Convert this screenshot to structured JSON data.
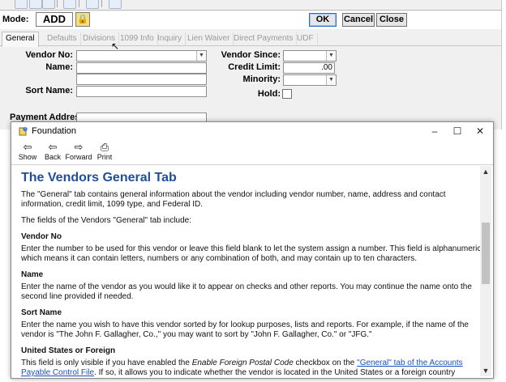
{
  "mode": {
    "label": "Mode:",
    "value": "ADD"
  },
  "header_buttons": {
    "ok": "OK",
    "cancel": "Cancel",
    "close": "Close"
  },
  "tabs": [
    {
      "label": "General",
      "active": true
    },
    {
      "label": "Defaults"
    },
    {
      "label": "Divisions"
    },
    {
      "label": "1099 Info"
    },
    {
      "label": "Inquiry"
    },
    {
      "label": "Lien Waiver"
    },
    {
      "label": "Direct Payments"
    },
    {
      "label": "UDF"
    }
  ],
  "form": {
    "vendor_no": "Vendor No:",
    "name": "Name:",
    "sort_name": "Sort Name:",
    "payment_address": "Payment Address:",
    "vendor_since": "Vendor Since:",
    "credit_limit": "Credit Limit:",
    "credit_limit_value": ".00",
    "minority": "Minority:",
    "hold": "Hold:"
  },
  "help_window": {
    "title": "Foundation",
    "toolbar": {
      "show": "Show",
      "back": "Back",
      "forward": "Forward",
      "print": "Print"
    },
    "heading": "The Vendors General Tab",
    "intro": "The \"General\" tab contains general information about the vendor including vendor number, name, address and contact information, credit limit, 1099 type, and Federal ID.",
    "intro2": "The fields of the Vendors \"General\" tab include:",
    "sections": [
      {
        "title": "Vendor No",
        "body": "Enter the number to be used for this vendor or leave this field blank to let the system assign a number. This field is alphanumeric, which means it can contain letters, numbers or any combination of both, and may contain up to ten characters."
      },
      {
        "title": "Name",
        "body": "Enter the name of the vendor as you would like it to appear on checks and other reports. You may continue the name onto the second line provided if needed."
      },
      {
        "title": "Sort Name",
        "body": "Enter the name you wish to have this vendor sorted by for lookup purposes, lists and reports. For example, if the name of the vendor is \"The John F. Gallagher, Co.,\" you may want to sort by \"John F. Gallagher, Co.\" or \"JFG.\""
      }
    ],
    "foreign": {
      "title": "United States or Foreign",
      "text_before": "This field is only visible if you have enabled the ",
      "text_em": "Enable Foreign Postal Code",
      "text_mid": " checkbox on the ",
      "link": "\"General\" tab of the Accounts Payable Control File",
      "text_after": ". If so, it allows you to indicate whether the vendor is located in the United States or a foreign country (including Canada, Mexico, etc.). If"
    }
  }
}
